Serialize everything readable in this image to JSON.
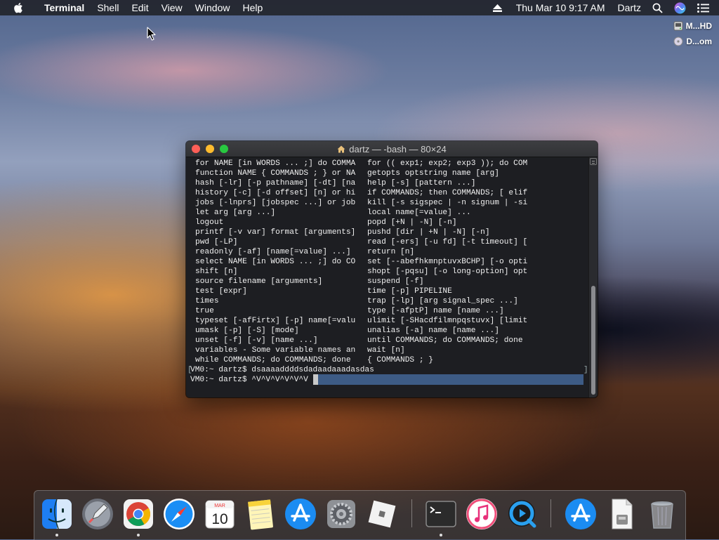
{
  "menubar": {
    "app_name": "Terminal",
    "menus": [
      "Shell",
      "Edit",
      "View",
      "Window",
      "Help"
    ],
    "datetime": "Thu Mar 10  9:17 AM",
    "user": "Dartz",
    "status_icons": [
      "eject-icon",
      "search-icon",
      "siri-icon",
      "notification-center-icon"
    ]
  },
  "desktop": {
    "icons": [
      {
        "label": "M...HD",
        "icon": "hard-drive-icon"
      },
      {
        "label": "D...om",
        "icon": "disk-image-icon"
      }
    ]
  },
  "terminal": {
    "title": "dartz — -bash — 80×24",
    "lines": [
      {
        "left": "for NAME [in WORDS ... ;] do COMMA",
        "right": "for (( exp1; exp2; exp3 )); do COM"
      },
      {
        "left": "function NAME { COMMANDS ; } or NA",
        "right": "getopts optstring name [arg]"
      },
      {
        "left": "hash [-lr] [-p pathname] [-dt] [na",
        "right": "help [-s] [pattern ...]"
      },
      {
        "left": "history [-c] [-d offset] [n] or hi",
        "right": "if COMMANDS; then COMMANDS; [ elif"
      },
      {
        "left": "jobs [-lnprs] [jobspec ...] or job",
        "right": "kill [-s sigspec | -n signum | -si"
      },
      {
        "left": "let arg [arg ...]",
        "right": "local name[=value] ..."
      },
      {
        "left": "logout",
        "right": "popd [+N | -N] [-n]"
      },
      {
        "left": "printf [-v var] format [arguments]",
        "right": "pushd [dir | +N | -N] [-n]"
      },
      {
        "left": "pwd [-LP]",
        "right": "read [-ers] [-u fd] [-t timeout] ["
      },
      {
        "left": "readonly [-af] [name[=value] ...]",
        "right": "return [n]"
      },
      {
        "left": "select NAME [in WORDS ... ;] do CO",
        "right": "set [--abefhkmnptuvxBCHP] [-o opti"
      },
      {
        "left": "shift [n]",
        "right": "shopt [-pqsu] [-o long-option] opt"
      },
      {
        "left": "source filename [arguments]",
        "right": "suspend [-f]"
      },
      {
        "left": "test [expr]",
        "right": "time [-p] PIPELINE"
      },
      {
        "left": "times",
        "right": "trap [-lp] [arg signal_spec ...]"
      },
      {
        "left": "true",
        "right": "type [-afptP] name [name ...]"
      },
      {
        "left": "typeset [-afFirtx] [-p] name[=valu",
        "right": "ulimit [-SHacdfilmnpqstuvx] [limit"
      },
      {
        "left": "umask [-p] [-S] [mode]",
        "right": "unalias [-a] name [name ...]"
      },
      {
        "left": "unset [-f] [-v] [name ...]",
        "right": "until COMMANDS; do COMMANDS; done"
      },
      {
        "left": "variables - Some variable names an",
        "right": "wait [n]"
      },
      {
        "left": "while COMMANDS; do COMMANDS; done",
        "right": "{ COMMANDS ; }"
      }
    ],
    "prompt1": "VM0:~ dartz$ dsaaaaddddsdadaadaaadasdas",
    "prompt2": "VM0:~ dartz$ ^V^V^V^V^V^V"
  },
  "dock": {
    "apps": [
      {
        "name": "Finder",
        "icon": "finder-icon",
        "running": true
      },
      {
        "name": "Launchpad",
        "icon": "launchpad-icon",
        "running": false
      },
      {
        "name": "Google Chrome",
        "icon": "chrome-icon",
        "running": true
      },
      {
        "name": "Safari",
        "icon": "safari-icon",
        "running": false
      },
      {
        "name": "Calendar",
        "icon": "calendar-icon",
        "running": false,
        "month": "MAR",
        "day": "10"
      },
      {
        "name": "Notes",
        "icon": "notes-icon",
        "running": false
      },
      {
        "name": "App Store",
        "icon": "app-store-icon",
        "running": false
      },
      {
        "name": "System Preferences",
        "icon": "system-preferences-icon",
        "running": false
      },
      {
        "name": "Roblox",
        "icon": "roblox-icon",
        "running": false
      },
      {
        "name": "Terminal",
        "icon": "terminal-icon",
        "running": true
      },
      {
        "name": "iTunes",
        "icon": "itunes-icon",
        "running": false
      },
      {
        "name": "QuickTime Player",
        "icon": "quicktime-icon",
        "running": false
      },
      {
        "name": "App Store Downloads",
        "icon": "downloads-icon",
        "running": false
      },
      {
        "name": "Document",
        "icon": "document-icon",
        "running": false
      },
      {
        "name": "Trash",
        "icon": "trash-icon",
        "running": false
      }
    ]
  }
}
